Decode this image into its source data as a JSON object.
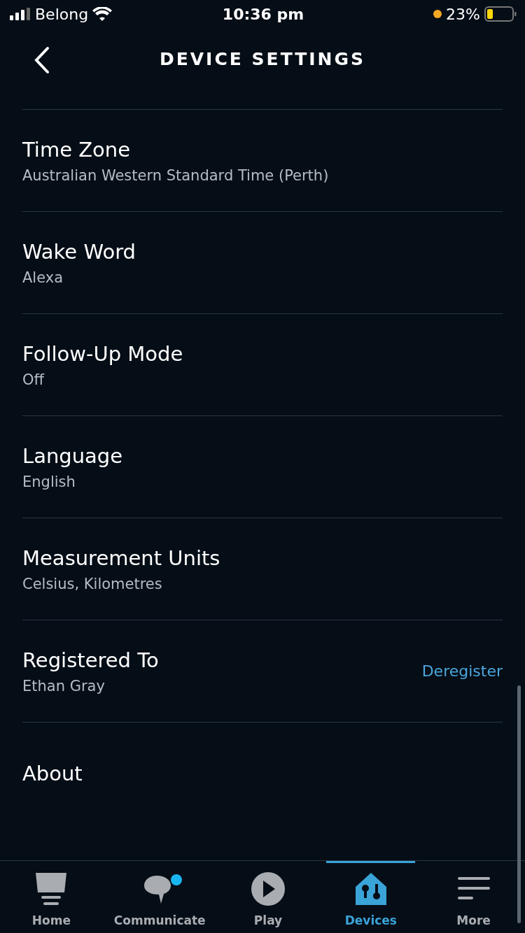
{
  "status_bar": {
    "carrier": "Belong",
    "time": "10:36 pm",
    "battery": "23%"
  },
  "header": {
    "title": "DEVICE SETTINGS"
  },
  "settings": [
    {
      "title": "Time Zone",
      "value": "Australian Western Standard Time (Perth)"
    },
    {
      "title": "Wake Word",
      "value": "Alexa"
    },
    {
      "title": "Follow-Up Mode",
      "value": "Off"
    },
    {
      "title": "Language",
      "value": "English"
    },
    {
      "title": "Measurement Units",
      "value": "Celsius, Kilometres"
    },
    {
      "title": "Registered To",
      "value": "Ethan Gray",
      "action": "Deregister"
    },
    {
      "title": "About"
    }
  ],
  "tab_bar": [
    {
      "kind": "home",
      "label": "Home",
      "selected": false,
      "notification": false
    },
    {
      "kind": "communicate",
      "label": "Communicate",
      "selected": false,
      "notification": true
    },
    {
      "kind": "play",
      "label": "Play",
      "selected": false,
      "notification": false
    },
    {
      "kind": "devices",
      "label": "Devices",
      "selected": true,
      "notification": false
    },
    {
      "kind": "more",
      "label": "More",
      "selected": false,
      "notification": false
    }
  ]
}
